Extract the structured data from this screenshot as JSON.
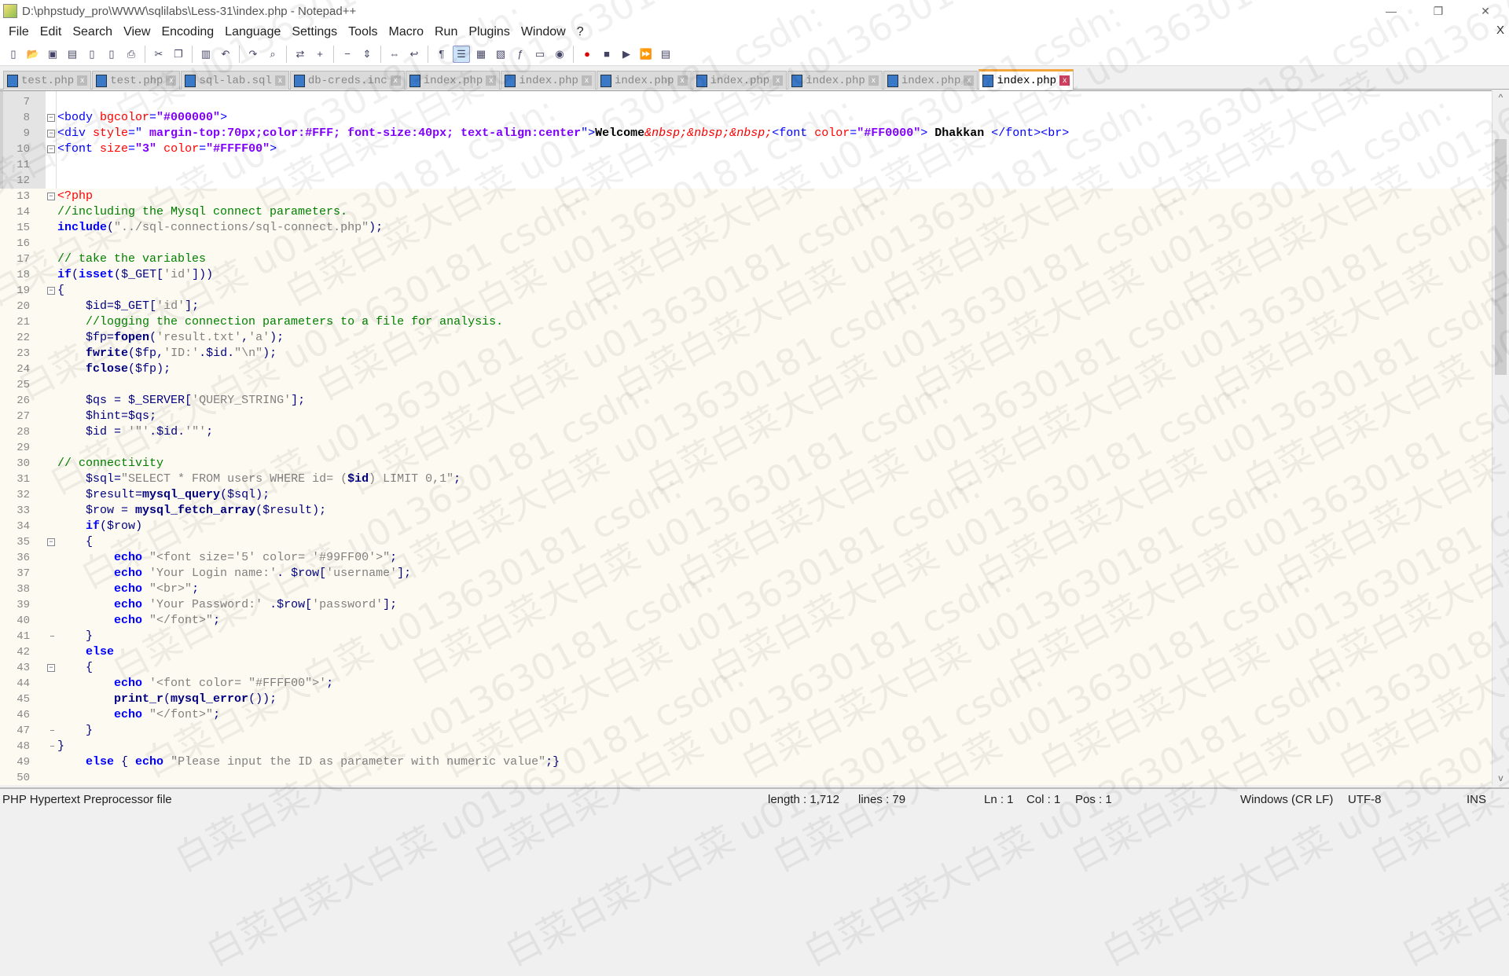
{
  "window": {
    "title": "D:\\phpstudy_pro\\WWW\\sqlilabs\\Less-31\\index.php - Notepad++",
    "minimize": "—",
    "restore": "❐",
    "close": "✕",
    "menu_close": "X"
  },
  "menu": [
    "File",
    "Edit",
    "Search",
    "View",
    "Encoding",
    "Language",
    "Settings",
    "Tools",
    "Macro",
    "Run",
    "Plugins",
    "Window",
    "?"
  ],
  "toolbar": [
    "new-file",
    "open-file",
    "save",
    "save-all",
    "close",
    "close-all",
    "print",
    "cut",
    "copy",
    "paste",
    "undo",
    "redo",
    "find",
    "replace",
    "zoom-in",
    "zoom-out",
    "sync-v",
    "sync-h",
    "word-wrap",
    "show-all-chars",
    "indent-guide",
    "udl",
    "doc-map",
    "function-list",
    "folder-workspace",
    "monitor",
    "record-macro",
    "stop-record",
    "play-macro",
    "run-macro-multiple",
    "save-macro"
  ],
  "tabs": [
    {
      "label": "test.php"
    },
    {
      "label": "test.php"
    },
    {
      "label": "sql-lab.sql"
    },
    {
      "label": "db-creds.inc"
    },
    {
      "label": "index.php"
    },
    {
      "label": "index.php"
    },
    {
      "label": "index.php"
    },
    {
      "label": "index.php"
    },
    {
      "label": "index.php"
    },
    {
      "label": "index.php"
    },
    {
      "label": "index.php",
      "active": true
    }
  ],
  "editor": {
    "first_line": 7,
    "lines": [
      [],
      [
        [
          "tag",
          "<body "
        ],
        [
          "attr",
          "bgcolor"
        ],
        [
          "tag",
          "="
        ],
        [
          "aval",
          "\"#000000\""
        ],
        [
          "tag",
          ">"
        ]
      ],
      [
        [
          "tag",
          "<div "
        ],
        [
          "attr",
          "style"
        ],
        [
          "tag",
          "=\""
        ],
        [
          "aval",
          " margin-top:70px;color:#FFF; font-size:40px; text-align:center"
        ],
        [
          "tag",
          "\">"
        ],
        [
          "txt",
          "Welcome"
        ],
        [
          "ent",
          "&nbsp;&nbsp;&nbsp;"
        ],
        [
          "tag",
          "<font "
        ],
        [
          "attr",
          "color"
        ],
        [
          "tag",
          "="
        ],
        [
          "aval",
          "\"#FF0000\""
        ],
        [
          "tag",
          "> "
        ],
        [
          "txt",
          "Dhakkan "
        ],
        [
          "tag",
          "</font><br>"
        ]
      ],
      [
        [
          "tag",
          "<font "
        ],
        [
          "attr",
          "size"
        ],
        [
          "tag",
          "="
        ],
        [
          "aval",
          "\"3\""
        ],
        [
          "tag",
          " "
        ],
        [
          "attr",
          "color"
        ],
        [
          "tag",
          "="
        ],
        [
          "aval",
          "\"#FFFF00\""
        ],
        [
          "tag",
          ">"
        ]
      ],
      [],
      [],
      [
        [
          "phpo",
          "<?php"
        ]
      ],
      [
        [
          "cm",
          "//including the Mysql connect parameters."
        ]
      ],
      [
        [
          "kw",
          "include"
        ],
        [
          "op",
          "("
        ],
        [
          "str",
          "\"../sql-connections/sql-connect.php\""
        ],
        [
          "op",
          ");"
        ]
      ],
      [],
      [
        [
          "cm",
          "// take the variables"
        ]
      ],
      [
        [
          "kw",
          "if"
        ],
        [
          "op",
          "("
        ],
        [
          "kw",
          "isset"
        ],
        [
          "op",
          "("
        ],
        [
          "var",
          "$_GET"
        ],
        [
          "op",
          "["
        ],
        [
          "str",
          "'id'"
        ],
        [
          "op",
          "]))"
        ]
      ],
      [
        [
          "op",
          "{"
        ]
      ],
      [
        [
          "pl",
          "    "
        ],
        [
          "var",
          "$id"
        ],
        [
          "op",
          "="
        ],
        [
          "var",
          "$_GET"
        ],
        [
          "op",
          "["
        ],
        [
          "str",
          "'id'"
        ],
        [
          "op",
          "];"
        ]
      ],
      [
        [
          "pl",
          "    "
        ],
        [
          "cm",
          "//logging the connection parameters to a file for analysis."
        ]
      ],
      [
        [
          "pl",
          "    "
        ],
        [
          "var",
          "$fp"
        ],
        [
          "op",
          "="
        ],
        [
          "fn",
          "fopen"
        ],
        [
          "op",
          "("
        ],
        [
          "str",
          "'result.txt'"
        ],
        [
          "op",
          ","
        ],
        [
          "str",
          "'a'"
        ],
        [
          "op",
          ");"
        ]
      ],
      [
        [
          "pl",
          "    "
        ],
        [
          "fn",
          "fwrite"
        ],
        [
          "op",
          "("
        ],
        [
          "var",
          "$fp"
        ],
        [
          "op",
          ","
        ],
        [
          "str",
          "'ID:'"
        ],
        [
          "op",
          "."
        ],
        [
          "var",
          "$id"
        ],
        [
          "op",
          "."
        ],
        [
          "str",
          "\"\\n\""
        ],
        [
          "op",
          ");"
        ]
      ],
      [
        [
          "pl",
          "    "
        ],
        [
          "fn",
          "fclose"
        ],
        [
          "op",
          "("
        ],
        [
          "var",
          "$fp"
        ],
        [
          "op",
          ");"
        ]
      ],
      [],
      [
        [
          "pl",
          "    "
        ],
        [
          "var",
          "$qs"
        ],
        [
          "op",
          " = "
        ],
        [
          "var",
          "$_SERVER"
        ],
        [
          "op",
          "["
        ],
        [
          "str",
          "'QUERY_STRING'"
        ],
        [
          "op",
          "];"
        ]
      ],
      [
        [
          "pl",
          "    "
        ],
        [
          "var",
          "$hint"
        ],
        [
          "op",
          "="
        ],
        [
          "var",
          "$qs"
        ],
        [
          "op",
          ";"
        ]
      ],
      [
        [
          "pl",
          "    "
        ],
        [
          "var",
          "$id"
        ],
        [
          "op",
          " = "
        ],
        [
          "str",
          "'\"'"
        ],
        [
          "op",
          "."
        ],
        [
          "var",
          "$id"
        ],
        [
          "op",
          "."
        ],
        [
          "str",
          "'\"'"
        ],
        [
          "op",
          ";"
        ]
      ],
      [],
      [
        [
          "cm",
          "// connectivity"
        ]
      ],
      [
        [
          "pl",
          "    "
        ],
        [
          "var",
          "$sql"
        ],
        [
          "op",
          "="
        ],
        [
          "str",
          "\"SELECT * FROM users WHERE id= ("
        ],
        [
          "fn",
          "$id"
        ],
        [
          "str",
          ") LIMIT 0,1\""
        ],
        [
          "op",
          ";"
        ]
      ],
      [
        [
          "pl",
          "    "
        ],
        [
          "var",
          "$result"
        ],
        [
          "op",
          "="
        ],
        [
          "fn",
          "mysql_query"
        ],
        [
          "op",
          "("
        ],
        [
          "var",
          "$sql"
        ],
        [
          "op",
          ");"
        ]
      ],
      [
        [
          "pl",
          "    "
        ],
        [
          "var",
          "$row"
        ],
        [
          "op",
          " = "
        ],
        [
          "fn",
          "mysql_fetch_array"
        ],
        [
          "op",
          "("
        ],
        [
          "var",
          "$result"
        ],
        [
          "op",
          ");"
        ]
      ],
      [
        [
          "pl",
          "    "
        ],
        [
          "kw",
          "if"
        ],
        [
          "op",
          "("
        ],
        [
          "var",
          "$row"
        ],
        [
          "op",
          ")"
        ]
      ],
      [
        [
          "pl",
          "    "
        ],
        [
          "op",
          "{"
        ]
      ],
      [
        [
          "pl",
          "        "
        ],
        [
          "kw",
          "echo"
        ],
        [
          "pl",
          " "
        ],
        [
          "str",
          "\"<font size='5' color= '#99FF00'>\""
        ],
        [
          "op",
          ";"
        ]
      ],
      [
        [
          "pl",
          "        "
        ],
        [
          "kw",
          "echo"
        ],
        [
          "pl",
          " "
        ],
        [
          "str",
          "'Your Login name:'"
        ],
        [
          "op",
          ". "
        ],
        [
          "var",
          "$row"
        ],
        [
          "op",
          "["
        ],
        [
          "str",
          "'username'"
        ],
        [
          "op",
          "];"
        ]
      ],
      [
        [
          "pl",
          "        "
        ],
        [
          "kw",
          "echo"
        ],
        [
          "pl",
          " "
        ],
        [
          "str",
          "\"<br>\""
        ],
        [
          "op",
          ";"
        ]
      ],
      [
        [
          "pl",
          "        "
        ],
        [
          "kw",
          "echo"
        ],
        [
          "pl",
          " "
        ],
        [
          "str",
          "'Your Password:'"
        ],
        [
          "op",
          " ."
        ],
        [
          "var",
          "$row"
        ],
        [
          "op",
          "["
        ],
        [
          "str",
          "'password'"
        ],
        [
          "op",
          "];"
        ]
      ],
      [
        [
          "pl",
          "        "
        ],
        [
          "kw",
          "echo"
        ],
        [
          "pl",
          " "
        ],
        [
          "str",
          "\"</font>\""
        ],
        [
          "op",
          ";"
        ]
      ],
      [
        [
          "pl",
          "    "
        ],
        [
          "op",
          "}"
        ]
      ],
      [
        [
          "pl",
          "    "
        ],
        [
          "kw",
          "else"
        ]
      ],
      [
        [
          "pl",
          "    "
        ],
        [
          "op",
          "{"
        ]
      ],
      [
        [
          "pl",
          "        "
        ],
        [
          "kw",
          "echo"
        ],
        [
          "pl",
          " "
        ],
        [
          "str",
          "'<font color= \"#FFFF00\">'"
        ],
        [
          "op",
          ";"
        ]
      ],
      [
        [
          "pl",
          "        "
        ],
        [
          "fn",
          "print_r"
        ],
        [
          "op",
          "("
        ],
        [
          "fn",
          "mysql_error"
        ],
        [
          "op",
          "());"
        ]
      ],
      [
        [
          "pl",
          "        "
        ],
        [
          "kw",
          "echo"
        ],
        [
          "pl",
          " "
        ],
        [
          "str",
          "\"</font>\""
        ],
        [
          "op",
          ";"
        ]
      ],
      [
        [
          "pl",
          "    "
        ],
        [
          "op",
          "}"
        ]
      ],
      [
        [
          "op",
          "}"
        ]
      ],
      [
        [
          "pl",
          "    "
        ],
        [
          "kw",
          "else"
        ],
        [
          "op",
          " { "
        ],
        [
          "kw",
          "echo"
        ],
        [
          "pl",
          " "
        ],
        [
          "str",
          "\"Please input the ID as parameter with numeric value\""
        ],
        [
          "op",
          ";}"
        ]
      ],
      []
    ],
    "fold_open_lines": [
      8,
      9,
      10,
      13,
      19,
      35,
      43
    ],
    "fold_end_lines": [
      41,
      47,
      48
    ],
    "php_from_line": 13
  },
  "watermark": [
    "白菜白菜大白菜",
    "u013630181",
    "csdn:"
  ],
  "status": {
    "file_type": "PHP Hypertext Preprocessor file",
    "length": "length : 1,712",
    "lines": "lines : 79",
    "ln": "Ln : 1",
    "col": "Col : 1",
    "pos": "Pos : 1",
    "eol": "Windows (CR LF)",
    "encoding": "UTF-8",
    "mode": "INS"
  }
}
